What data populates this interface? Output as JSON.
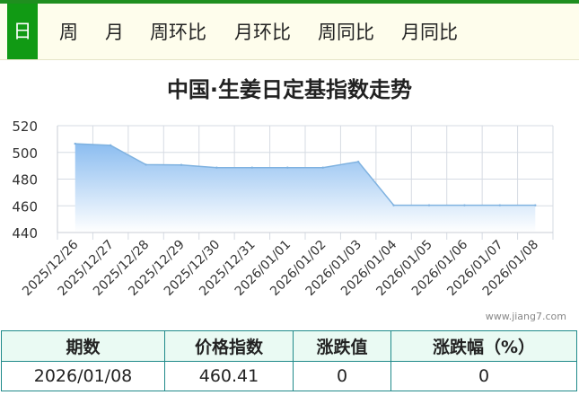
{
  "tabs": [
    {
      "label": "日",
      "active": true
    },
    {
      "label": "周"
    },
    {
      "label": "月"
    },
    {
      "label": "周环比"
    },
    {
      "label": "月环比"
    },
    {
      "label": "周同比"
    },
    {
      "label": "月同比"
    }
  ],
  "chart_title": "中国·生姜日定基指数走势",
  "watermark": "www.jiang7.com",
  "colors": {
    "accent": "#119a14",
    "area_line": "#7fb2e0",
    "area_fill_top": "#8cbdf0"
  },
  "chart_data": {
    "type": "area",
    "title": "中国·生姜日定基指数走势",
    "x": [
      "2025/12/26",
      "2025/12/27",
      "2025/12/28",
      "2025/12/29",
      "2025/12/30",
      "2025/12/31",
      "2026/01/01",
      "2026/01/02",
      "2026/01/03",
      "2026/01/04",
      "2026/01/05",
      "2026/01/06",
      "2026/01/07",
      "2026/01/08"
    ],
    "values": [
      506.5,
      505.3,
      490.8,
      490.6,
      488.6,
      488.6,
      488.6,
      488.6,
      493.0,
      460.41,
      460.41,
      460.41,
      460.41,
      460.41
    ],
    "ylim": [
      440,
      520
    ],
    "yticks": [
      440,
      460,
      480,
      500,
      520
    ],
    "grid": true
  },
  "table": {
    "headers": [
      "期数",
      "价格指数",
      "涨跌值",
      "涨跌幅（%）"
    ],
    "row": [
      "2026/01/08",
      "460.41",
      "0",
      "0"
    ]
  }
}
